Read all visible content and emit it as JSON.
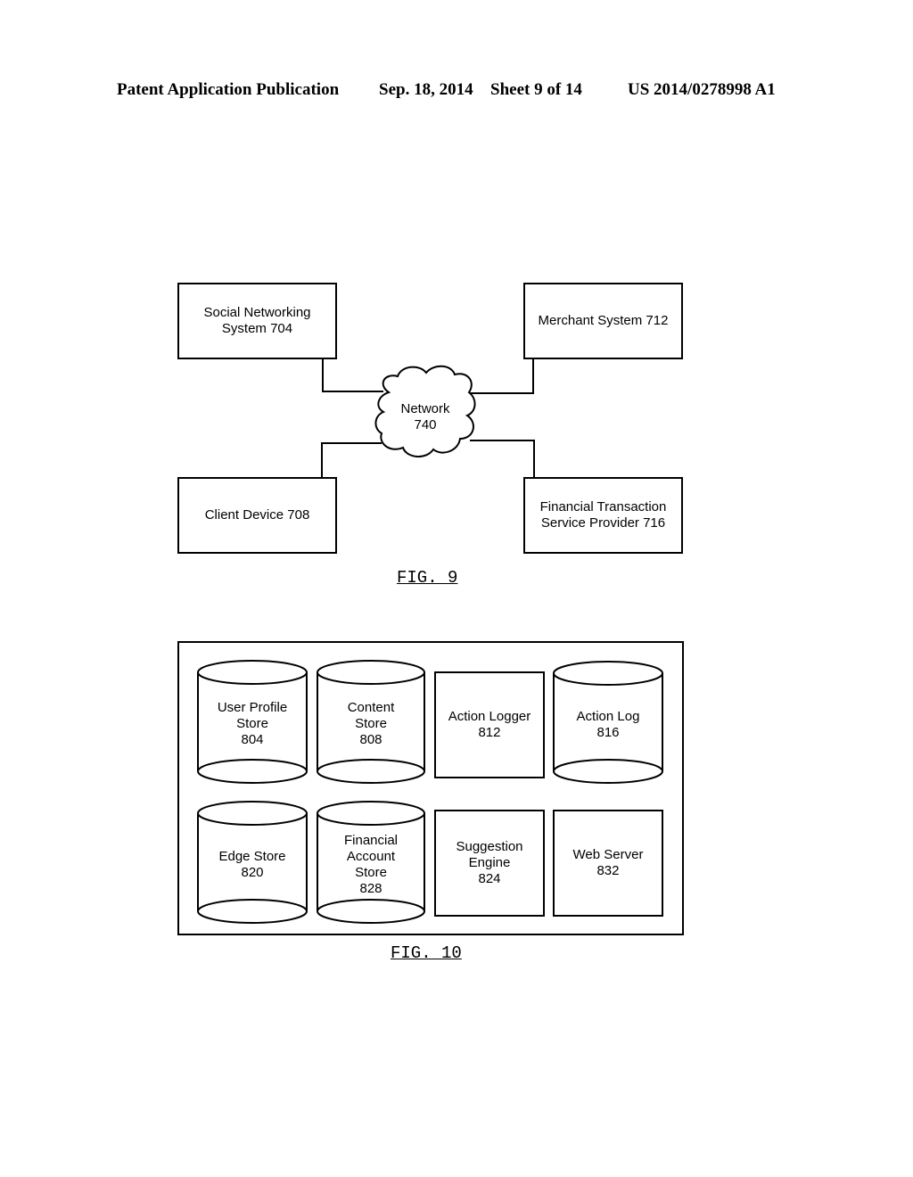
{
  "header": {
    "publication": "Patent Application Publication",
    "date": "Sep. 18, 2014",
    "sheet": "Sheet 9 of 14",
    "number": "US 2014/0278998 A1"
  },
  "fig9": {
    "caption": "FIG. 9",
    "network": "Network\n740",
    "nodes": {
      "social": "Social Networking\nSystem 704",
      "merchant": "Merchant System 712",
      "client": "Client Device 708",
      "financial": "Financial Transaction\nService Provider 716"
    }
  },
  "fig10": {
    "caption": "FIG. 10",
    "components": [
      {
        "label": "User Profile\nStore\n804",
        "shape": "cylinder"
      },
      {
        "label": "Content\nStore\n808",
        "shape": "cylinder"
      },
      {
        "label": "Action Logger\n812",
        "shape": "box"
      },
      {
        "label": "Action Log\n816",
        "shape": "cylinder"
      },
      {
        "label": "Edge Store\n820",
        "shape": "cylinder"
      },
      {
        "label": "Financial\nAccount\nStore\n828",
        "shape": "cylinder"
      },
      {
        "label": "Suggestion\nEngine\n824",
        "shape": "box"
      },
      {
        "label": "Web Server\n832",
        "shape": "box"
      }
    ]
  }
}
